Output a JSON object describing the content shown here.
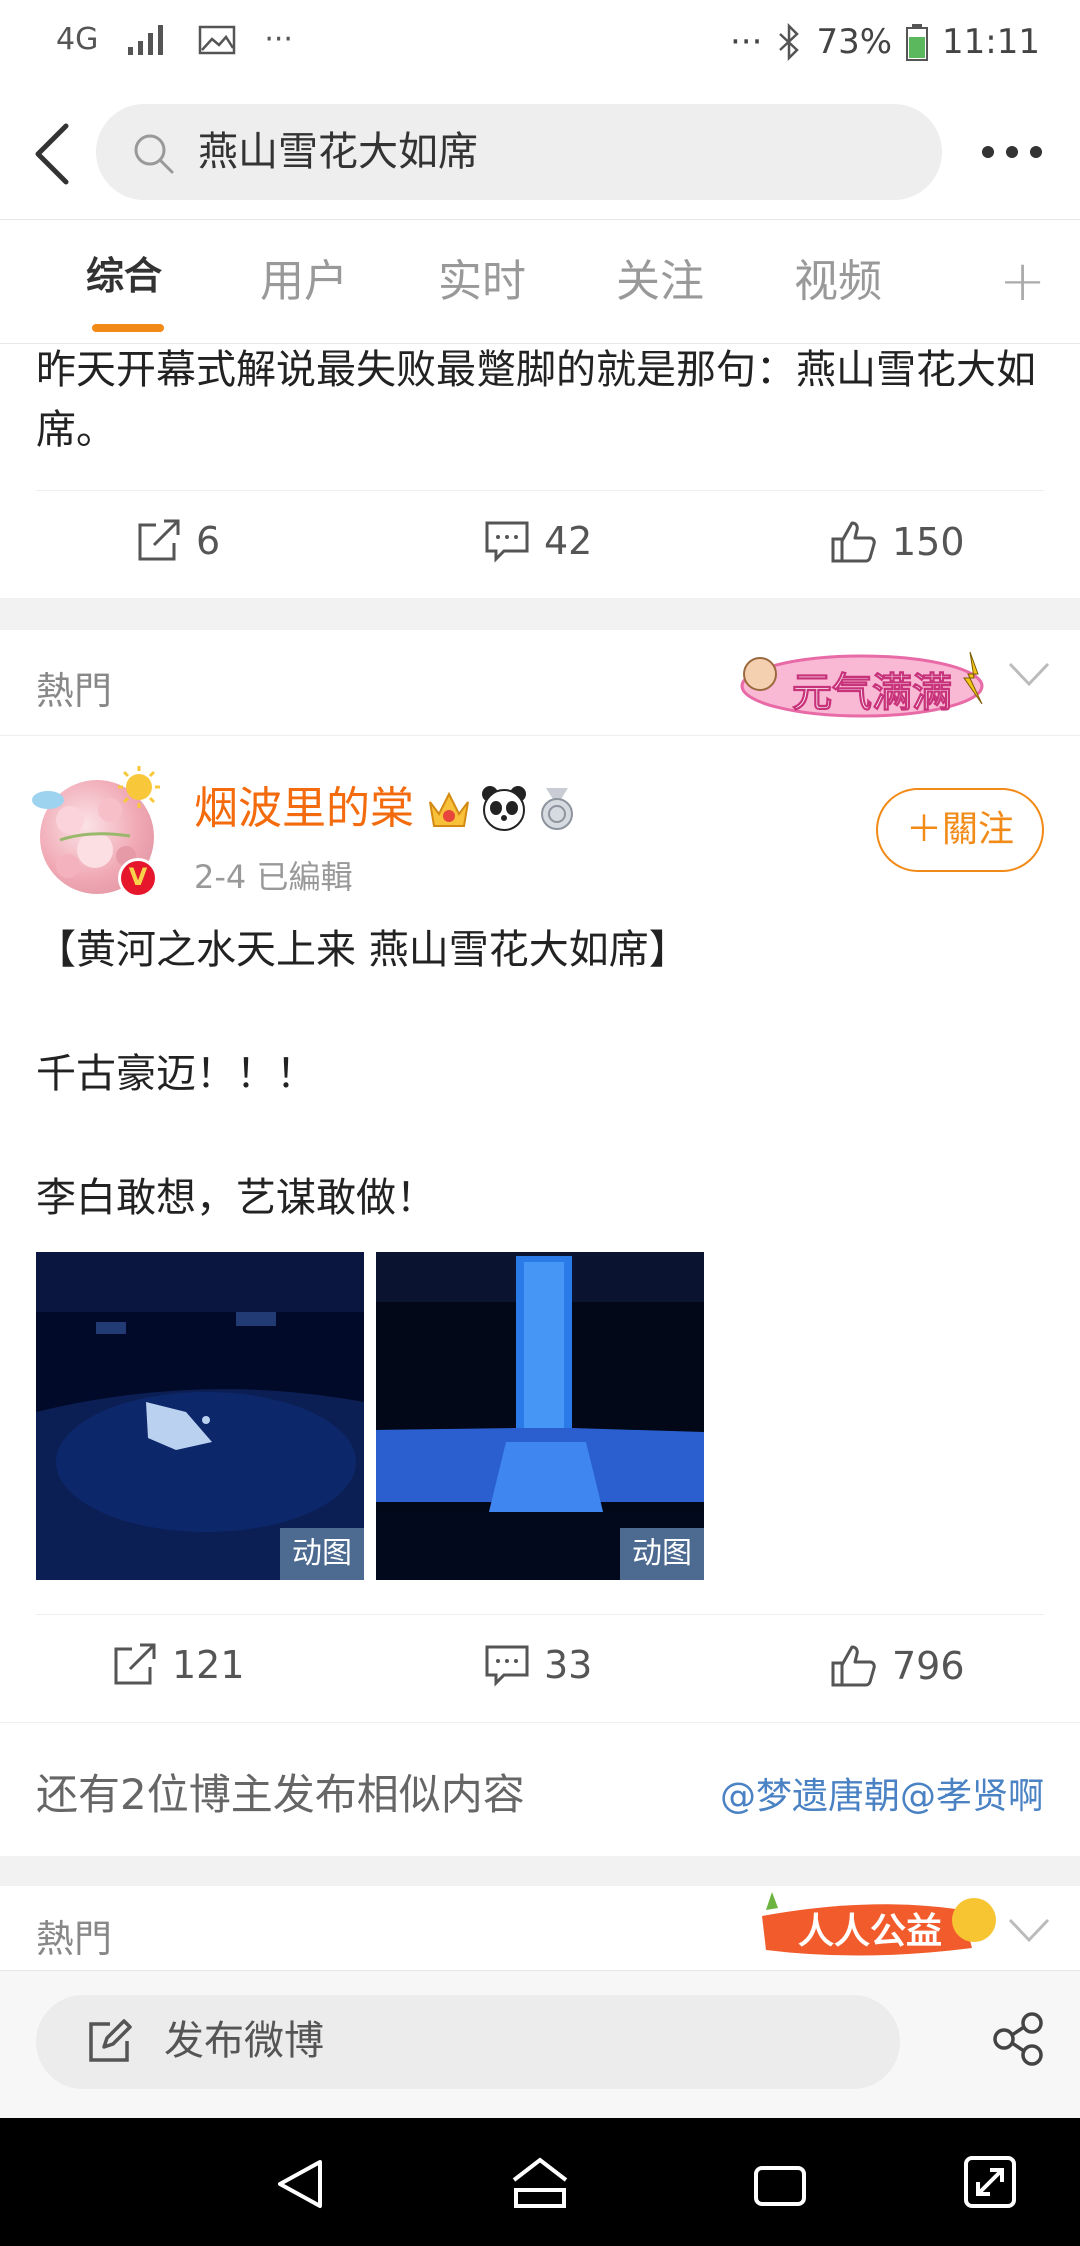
{
  "status_bar": {
    "network": "4G",
    "battery": "73%",
    "time": "11:11",
    "dots": "···"
  },
  "search": {
    "query": "燕山雪花大如席"
  },
  "tabs": [
    "综合",
    "用户",
    "实时",
    "关注",
    "视频"
  ],
  "post1": {
    "text": "昨天开幕式解说最失败最蹩脚的就是那句：燕山雪花大如席。",
    "reposts": "6",
    "comments": "42",
    "likes": "150"
  },
  "hot_label": "熱門",
  "hot_badge_1": "元气满满",
  "post2": {
    "username": "烟波里的棠",
    "meta": "2-4  已編輯",
    "follow_label": "＋關注",
    "line1": "【黄河之水天上来  燕山雪花大如席】",
    "line2": "千古豪迈！！！",
    "line3": "李白敢想，艺谋敢做！",
    "gif_label": "动图",
    "reposts": "121",
    "comments": "33",
    "likes": "796"
  },
  "similar": {
    "text": "还有2位博主发布相似内容",
    "users": "@梦遗唐朝@孝贤啊"
  },
  "hot_badge_2": "人人公益",
  "compose": {
    "placeholder": "发布微博"
  },
  "colors": {
    "accent": "#f28a17",
    "username": "#f36b0c",
    "link": "#4a82c4"
  }
}
